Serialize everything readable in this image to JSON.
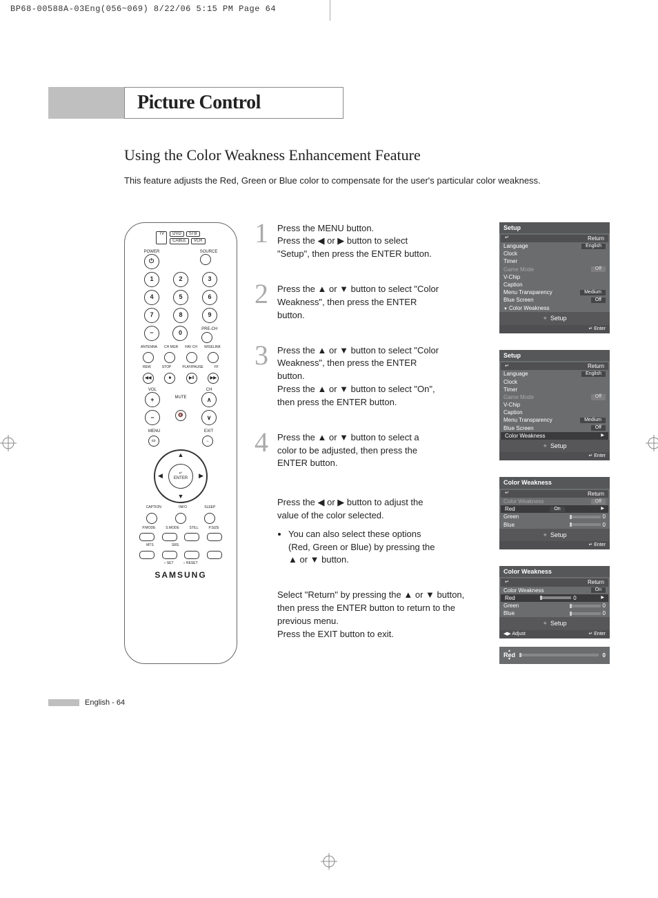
{
  "header_crop": "BP68-00588A-03Eng(056~069)  8/22/06  5:15 PM  Page 64",
  "chapter_title": "Picture Control",
  "section_title": "Using the Color Weakness Enhancement Feature",
  "intro_text": "This feature adjusts the Red, Green or Blue color to compensate for the user's particular color weakness.",
  "remote": {
    "tv": "TV",
    "dvd": "DVD",
    "stb": "STB",
    "cable": "CABLE",
    "vcr": "VCR",
    "power": "POWER",
    "source": "SOURCE",
    "prech": "PRE-CH",
    "antenna": "ANTENNA",
    "chmgr": "CH MGR",
    "favch": "FAV CH",
    "wiselink": "WISELINK",
    "rew": "REW",
    "stop": "STOP",
    "play": "PLAY/PAUSE",
    "ff": "FF",
    "vol": "VOL",
    "ch": "CH",
    "mute": "MUTE",
    "menu": "MENU",
    "exit": "EXIT",
    "enter": "ENTER",
    "caption": "CAPTION",
    "info": "INFO",
    "sleep": "SLEEP",
    "pmode": "P.MODE",
    "smode": "S.MODE",
    "still": "STILL",
    "psize": "P.SIZE",
    "mts": "MTS",
    "srs": "SRS",
    "set": "SET",
    "reset": "RESET",
    "brand": "SAMSUNG"
  },
  "steps": [
    {
      "num": "1",
      "text": "Press the MENU button.\nPress the ◀ or ▶ button to select \"Setup\", then press the ENTER button."
    },
    {
      "num": "2",
      "text": "Press the ▲ or ▼ button to select \"Color Weakness\", then press the ENTER button."
    },
    {
      "num": "3",
      "text": "Press the ▲ or ▼ button to select \"Color Weakness\", then press the ENTER button.\nPress the ▲ or ▼ button to select \"On\", then press the ENTER button."
    },
    {
      "num": "4",
      "text": "Press the ▲ or ▼ button to select a color to be adjusted, then press the ENTER button.\n\nPress the ◀ or ▶ button to adjust the value of the color selected.",
      "bullet": "You can also select these options (Red, Green or Blue) by pressing the ▲ or ▼ button."
    }
  ],
  "footer_note": "Select \"Return\" by pressing the ▲ or ▼ button, then press the ENTER button to return to the previous menu.\nPress the EXIT button to exit.",
  "osd1": {
    "title": "Setup",
    "return": "Return",
    "rows": [
      {
        "label": "Language",
        "value": "English",
        "cls": ""
      },
      {
        "label": "Clock",
        "value": "",
        "cls": ""
      },
      {
        "label": "Timer",
        "value": "",
        "cls": ""
      },
      {
        "label": "Game Mode",
        "value": "Off",
        "cls": "dim"
      },
      {
        "label": "V-Chip",
        "value": "",
        "cls": ""
      },
      {
        "label": "Caption",
        "value": "",
        "cls": ""
      },
      {
        "label": "Menu Transparency",
        "value": "Medium",
        "cls": ""
      },
      {
        "label": "Blue Screen",
        "value": "Off",
        "cls": ""
      },
      {
        "label": "Color Weakness",
        "value": "",
        "cls": "tri"
      }
    ],
    "setup": "Setup",
    "enter": "Enter"
  },
  "osd2": {
    "title": "Setup",
    "return": "Return",
    "rows": [
      {
        "label": "Language",
        "value": "English"
      },
      {
        "label": "Clock",
        "value": ""
      },
      {
        "label": "Timer",
        "value": ""
      },
      {
        "label": "Game Mode",
        "value": "Off",
        "cls": "dim"
      },
      {
        "label": "V-Chip",
        "value": ""
      },
      {
        "label": "Caption",
        "value": ""
      },
      {
        "label": "Menu Transparency",
        "value": "Medium"
      },
      {
        "label": "Blue Screen",
        "value": "Off"
      },
      {
        "label": "Color Weakness",
        "value": "",
        "cls": "hl"
      }
    ],
    "setup": "Setup",
    "enter": "Enter"
  },
  "osd3": {
    "title": "Color Weakness",
    "return": "Return",
    "rows": [
      {
        "label": "Color Weakness",
        "value": "Off",
        "cls": "dim"
      },
      {
        "label": "Red",
        "value": "On",
        "cls": "hl"
      },
      {
        "label": "Green",
        "value": "",
        "slider": true,
        "num": "0"
      },
      {
        "label": "Blue",
        "value": "",
        "slider": true,
        "num": "0"
      }
    ],
    "setup": "Setup",
    "enter": "Enter"
  },
  "osd4": {
    "title": "Color Weakness",
    "return": "Return",
    "rows": [
      {
        "label": "Color Weakness",
        "value": "On"
      },
      {
        "label": "Red",
        "value": "",
        "slider": true,
        "num": "0",
        "cls": "hl"
      },
      {
        "label": "Green",
        "value": "",
        "slider": true,
        "num": "0"
      },
      {
        "label": "Blue",
        "value": "",
        "slider": true,
        "num": "0"
      }
    ],
    "setup": "Setup",
    "adjust": "Adjust",
    "enter": "Enter"
  },
  "redbar": {
    "label": "Red",
    "value": "0"
  },
  "page_footer": "English - 64"
}
